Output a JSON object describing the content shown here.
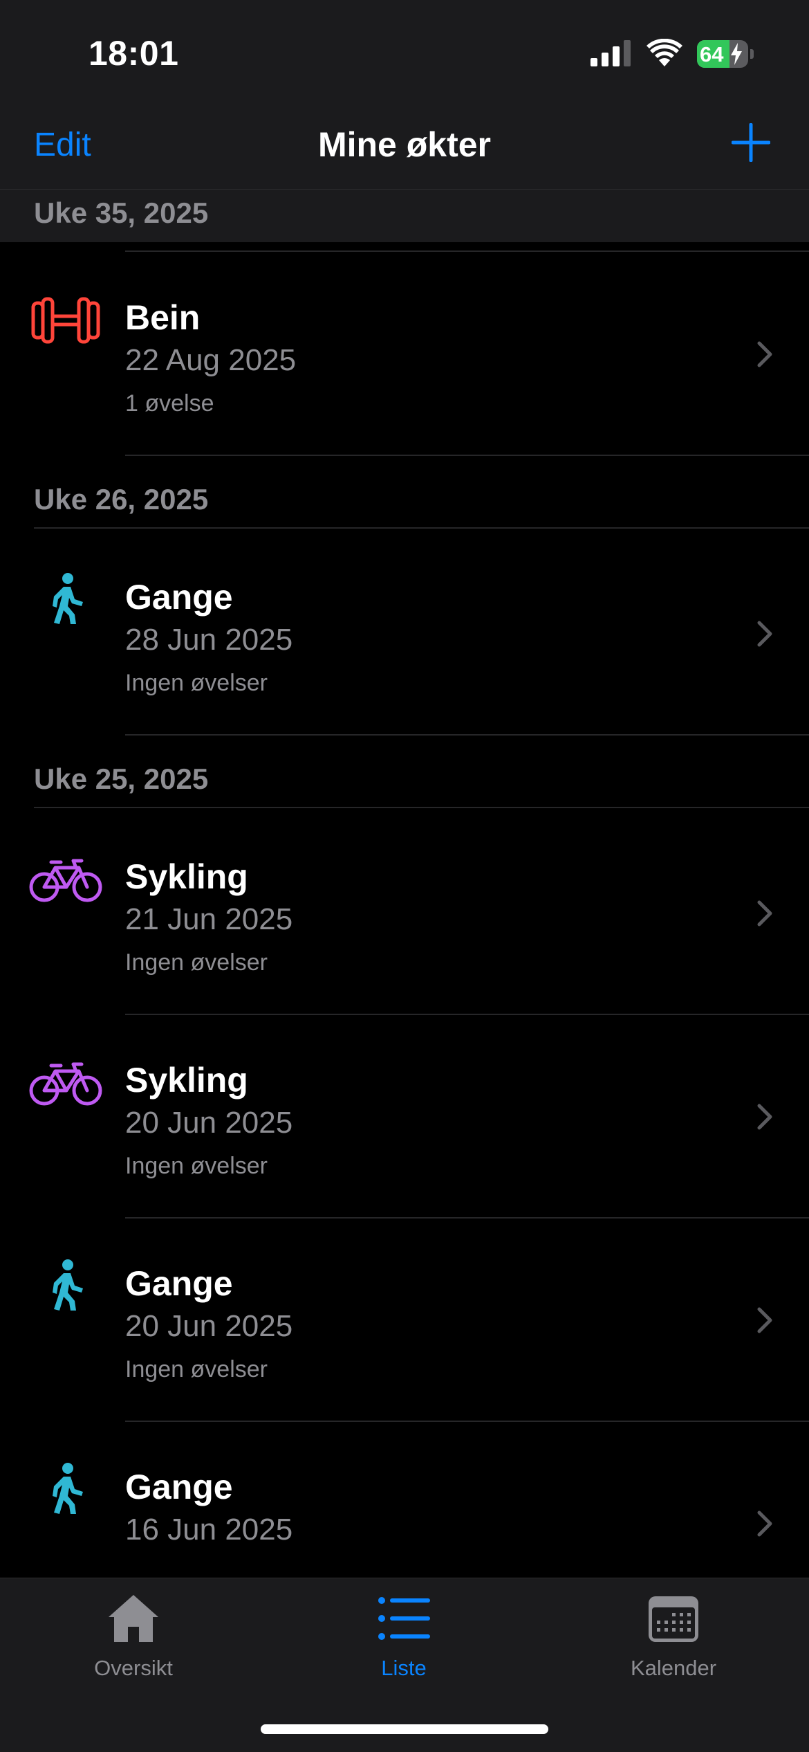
{
  "status_bar": {
    "time": "18:01",
    "battery_level": "64",
    "battery_fraction": 0.64,
    "icons": [
      "cellular-signal-icon",
      "wifi-icon",
      "battery-charging-icon"
    ]
  },
  "nav": {
    "edit_label": "Edit",
    "title": "Mine økter",
    "add_icon": "plus-icon"
  },
  "sections": [
    {
      "header": "Uke 35, 2025",
      "rows": [
        {
          "title": "Bein",
          "date": "22 Aug 2025",
          "subtitle": "1 øvelse",
          "icon": "dumbbell-icon",
          "color": "#ff453a"
        }
      ]
    },
    {
      "header": "Uke 26, 2025",
      "rows": [
        {
          "title": "Gange",
          "date": "28 Jun 2025",
          "subtitle": "Ingen øvelser",
          "icon": "walking-icon",
          "color": "#30b8d4"
        }
      ]
    },
    {
      "header": "Uke 25, 2025",
      "rows": [
        {
          "title": "Sykling",
          "date": "21 Jun 2025",
          "subtitle": "Ingen øvelser",
          "icon": "bicycle-icon",
          "color": "#bf5af2"
        },
        {
          "title": "Sykling",
          "date": "20 Jun 2025",
          "subtitle": "Ingen øvelser",
          "icon": "bicycle-icon",
          "color": "#bf5af2"
        },
        {
          "title": "Gange",
          "date": "20 Jun 2025",
          "subtitle": "Ingen øvelser",
          "icon": "walking-icon",
          "color": "#30b8d4"
        },
        {
          "title": "Gange",
          "date": "16 Jun 2025",
          "subtitle": "",
          "icon": "walking-icon",
          "color": "#30b8d4"
        }
      ]
    }
  ],
  "tab_bar": {
    "tabs": [
      {
        "label": "Oversikt",
        "icon": "house-icon",
        "selected": false
      },
      {
        "label": "Liste",
        "icon": "list-icon",
        "selected": true
      },
      {
        "label": "Kalender",
        "icon": "calendar-icon",
        "selected": false
      }
    ],
    "active_color": "#0a84ff",
    "inactive_color": "#8e8e93"
  }
}
